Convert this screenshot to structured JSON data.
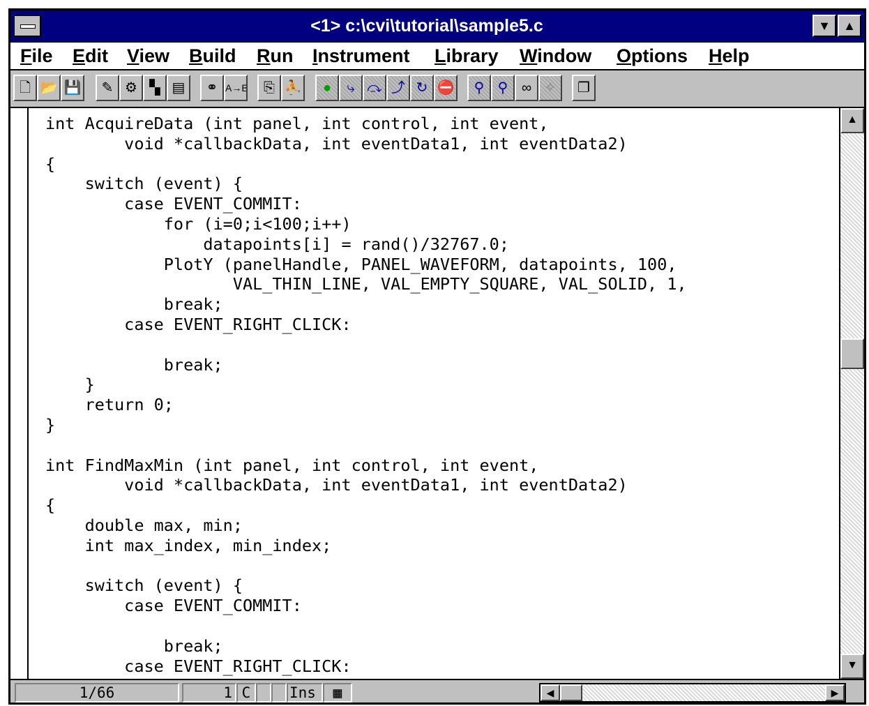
{
  "window": {
    "title": "<1> c:\\cvi\\tutorial\\sample5.c",
    "minimize_glyph": "▼",
    "maximize_glyph": "▲"
  },
  "menubar": {
    "items": [
      {
        "label": "File",
        "mnemonic": "F",
        "rest": "ile"
      },
      {
        "label": "Edit",
        "mnemonic": "E",
        "rest": "dit"
      },
      {
        "label": "View",
        "mnemonic": "V",
        "rest": "iew"
      },
      {
        "label": "Build",
        "mnemonic": "B",
        "rest": "uild"
      },
      {
        "label": "Run",
        "mnemonic": "R",
        "rest": "un"
      },
      {
        "label": "Instrument",
        "mnemonic": "I",
        "rest": "nstrument"
      },
      {
        "label": "Library",
        "mnemonic": "L",
        "rest": "ibrary"
      },
      {
        "label": "Window",
        "mnemonic": "W",
        "rest": "indow"
      },
      {
        "label": "Options",
        "mnemonic": "O",
        "rest": "ptions"
      },
      {
        "label": "Help",
        "mnemonic": "H",
        "rest": "elp"
      }
    ]
  },
  "toolbar": {
    "buttons": [
      {
        "icon": "new-document-icon",
        "glyph": "🗋"
      },
      {
        "icon": "open-folder-icon",
        "glyph": "📂"
      },
      {
        "icon": "save-disk-icon",
        "glyph": "💾"
      },
      {
        "icon": "edit-panel-icon",
        "glyph": "✎"
      },
      {
        "icon": "function-panel-icon",
        "glyph": "⚙"
      },
      {
        "icon": "instrument-icon",
        "glyph": "▚"
      },
      {
        "icon": "uir-icon",
        "glyph": "▤"
      },
      {
        "icon": "find-binoculars-icon",
        "glyph": "⚭"
      },
      {
        "icon": "replace-icon",
        "glyph": "A→B"
      },
      {
        "icon": "compile-icon",
        "glyph": "⎘"
      },
      {
        "icon": "run-icon",
        "glyph": "⛹"
      },
      {
        "icon": "go-icon",
        "glyph": "●"
      },
      {
        "icon": "step-into-icon",
        "glyph": "⤷"
      },
      {
        "icon": "step-over-icon",
        "glyph": "⤼"
      },
      {
        "icon": "step-finish-icon",
        "glyph": "⤴"
      },
      {
        "icon": "continue-icon",
        "glyph": "↻"
      },
      {
        "icon": "stop-icon",
        "glyph": "⛔"
      },
      {
        "icon": "breakpoint-icon",
        "glyph": "⚲"
      },
      {
        "icon": "watch-icon",
        "glyph": "⚲"
      },
      {
        "icon": "view-variables-icon",
        "glyph": "∞"
      },
      {
        "icon": "trace-icon",
        "glyph": "✧"
      },
      {
        "icon": "windows-cascade-icon",
        "glyph": "❐"
      }
    ]
  },
  "code_lines": [
    "int AcquireData (int panel, int control, int event,",
    "        void *callbackData, int eventData1, int eventData2)",
    "{",
    "    switch (event) {",
    "        case EVENT_COMMIT:",
    "            for (i=0;i<100;i++)",
    "                datapoints[i] = rand()/32767.0;",
    "            PlotY (panelHandle, PANEL_WAVEFORM, datapoints, 100,",
    "                   VAL_THIN_LINE, VAL_EMPTY_SQUARE, VAL_SOLID, 1,",
    "            break;",
    "        case EVENT_RIGHT_CLICK:",
    "",
    "            break;",
    "    }",
    "    return 0;",
    "}",
    "",
    "int FindMaxMin (int panel, int control, int event,",
    "        void *callbackData, int eventData1, int eventData2)",
    "{",
    "    double max, min;",
    "    int max_index, min_index;",
    "",
    "    switch (event) {",
    "        case EVENT_COMMIT:",
    "",
    "            break;",
    "        case EVENT_RIGHT_CLICK:"
  ],
  "scrollbar": {
    "up_glyph": "▲",
    "down_glyph": "▼",
    "left_glyph": "◀",
    "right_glyph": "▶"
  },
  "status": {
    "line_position": "1/66",
    "column": "1",
    "c_flag": "C",
    "blank": "",
    "mode": "Ins",
    "keyboard_glyph": "▦"
  }
}
